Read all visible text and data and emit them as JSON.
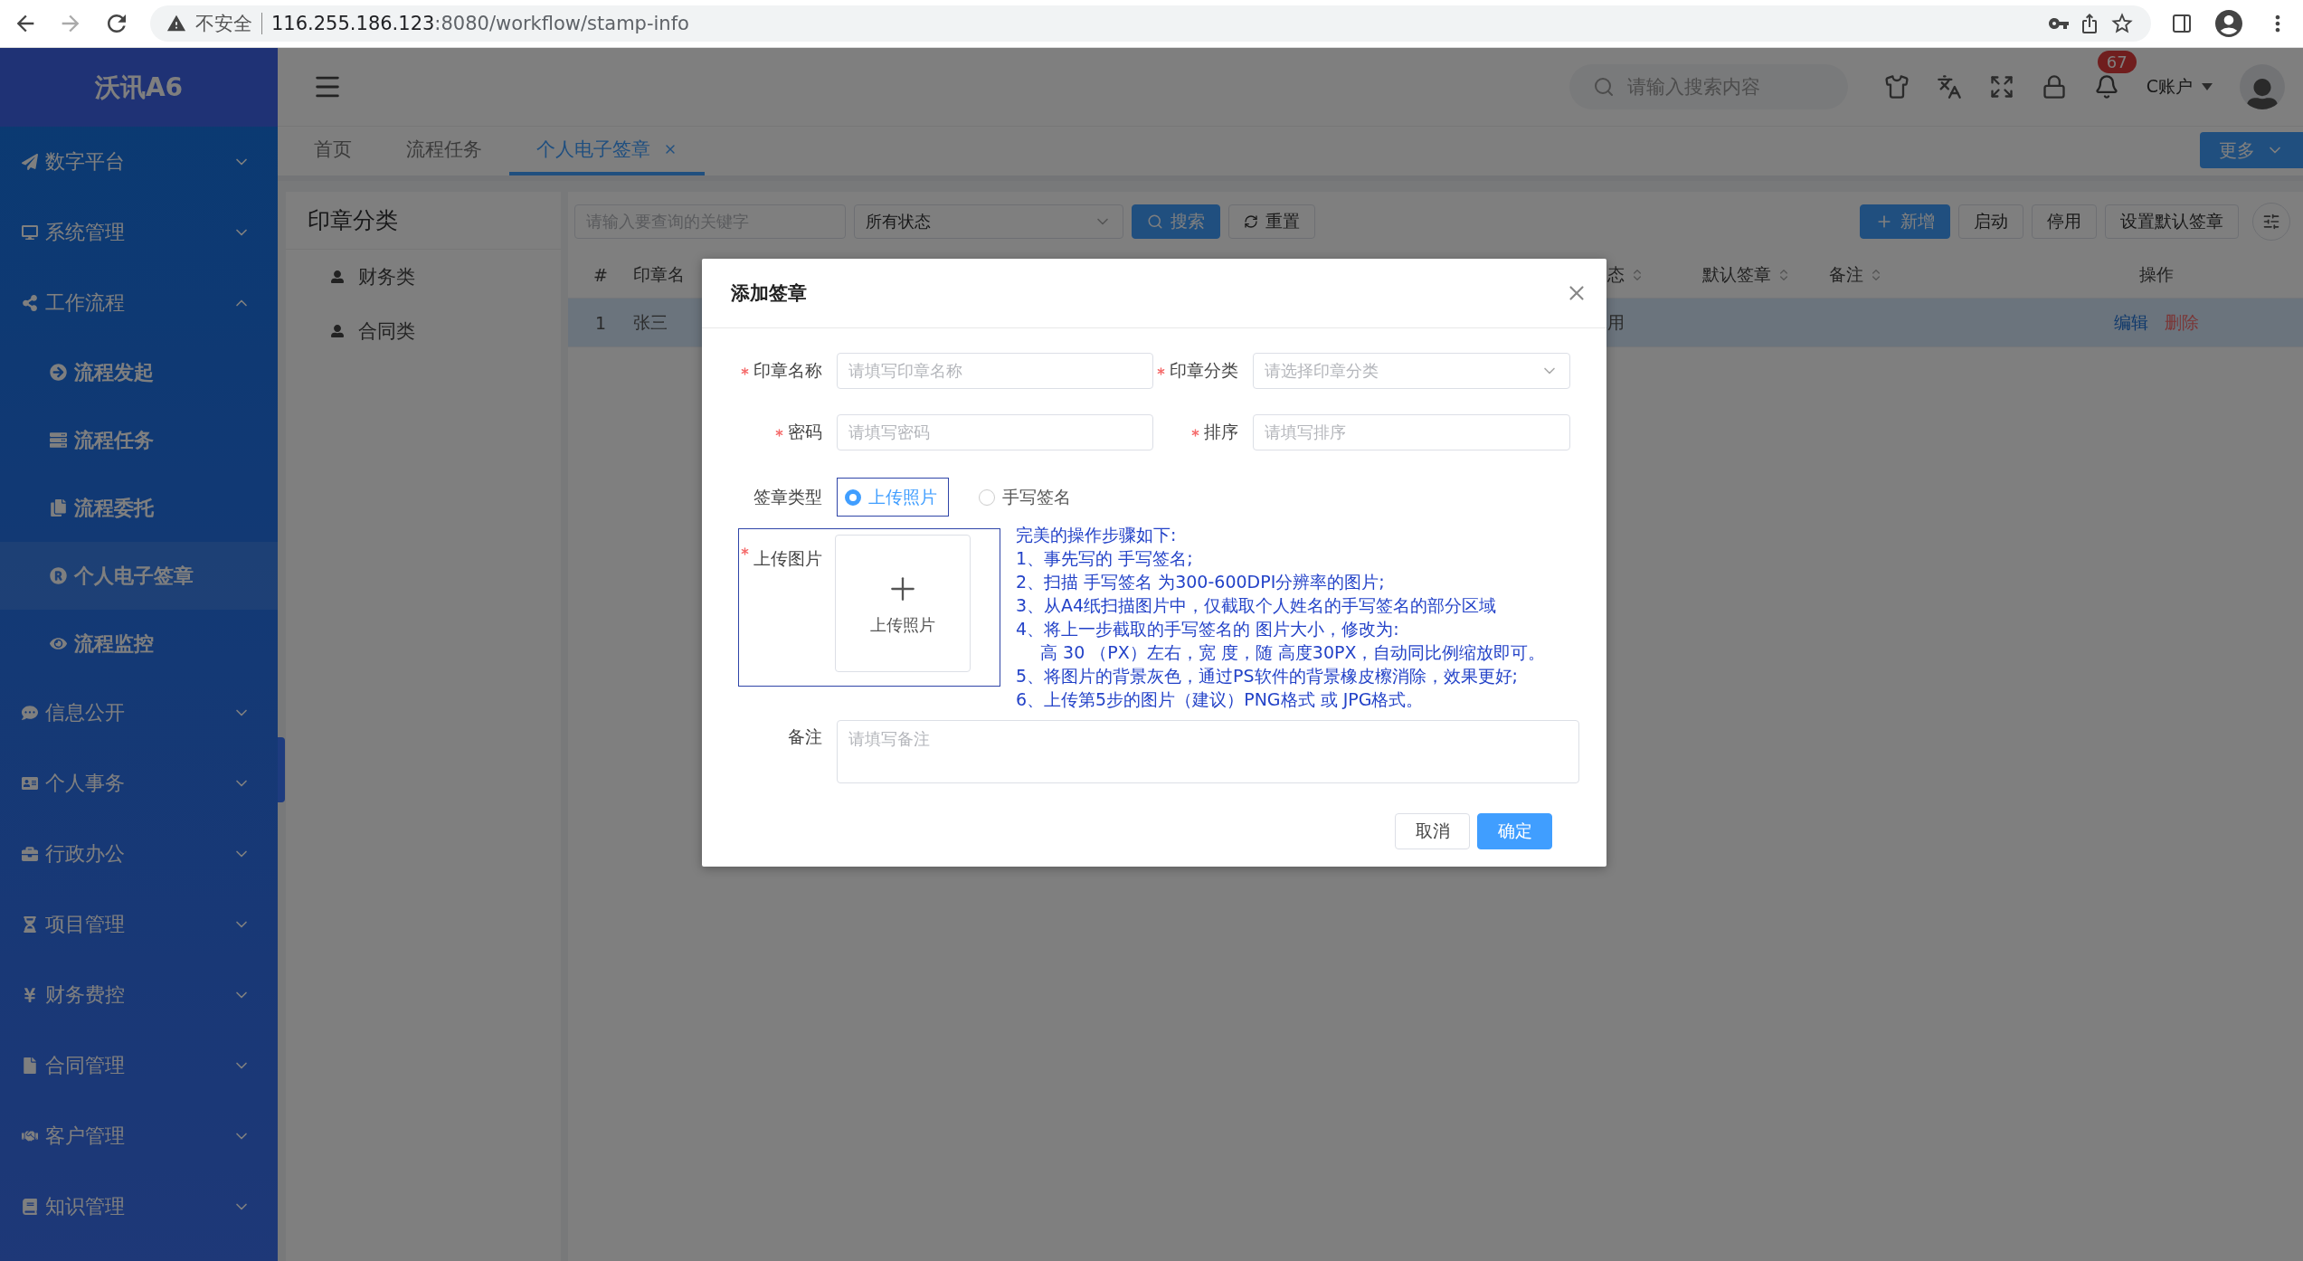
{
  "browser": {
    "security": "不安全",
    "url_host": "116.255.186.123",
    "url_path": ":8080/workflow/stamp-info"
  },
  "sidebar": {
    "logo": "沃讯A6",
    "items": [
      {
        "label": "数字平台",
        "expanded": false
      },
      {
        "label": "系统管理",
        "expanded": false
      },
      {
        "label": "工作流程",
        "expanded": true,
        "children": [
          {
            "label": "流程发起",
            "selected": false
          },
          {
            "label": "流程任务",
            "selected": false
          },
          {
            "label": "流程委托",
            "selected": false
          },
          {
            "label": "个人电子签章",
            "selected": true
          },
          {
            "label": "流程监控",
            "selected": false
          }
        ]
      },
      {
        "label": "信息公开",
        "expanded": false
      },
      {
        "label": "个人事务",
        "expanded": false
      },
      {
        "label": "行政办公",
        "expanded": false
      },
      {
        "label": "项目管理",
        "expanded": false
      },
      {
        "label": "财务费控",
        "expanded": false
      },
      {
        "label": "合同管理",
        "expanded": false
      },
      {
        "label": "客户管理",
        "expanded": false
      },
      {
        "label": "知识管理",
        "expanded": false
      }
    ]
  },
  "header": {
    "search_placeholder": "请输入搜索内容",
    "badge": "67",
    "account": "C账户"
  },
  "tabs": [
    {
      "label": "首页",
      "selected": false,
      "closable": false
    },
    {
      "label": "流程任务",
      "selected": false,
      "closable": false
    },
    {
      "label": "个人电子签章",
      "selected": true,
      "closable": true
    }
  ],
  "more_button": "更多",
  "category_panel": {
    "title": "印章分类",
    "items": [
      "财务类",
      "合同类"
    ]
  },
  "toolbar": {
    "keyword_placeholder": "请输入要查询的关键字",
    "status_select": "所有状态",
    "search": "搜索",
    "reset": "重置",
    "add": "新增",
    "buttons": [
      "启动",
      "停用",
      "设置默认签章"
    ]
  },
  "table": {
    "columns": [
      {
        "label": "#",
        "sortable": false
      },
      {
        "label": "印章名",
        "sortable": false
      },
      {
        "label": "态",
        "sortable": true
      },
      {
        "label": "默认签章",
        "sortable": true
      },
      {
        "label": "备注",
        "sortable": true
      },
      {
        "label": "操作",
        "sortable": false
      }
    ],
    "rows": [
      {
        "selected": true,
        "cells": [
          "1",
          "张三",
          "用"
        ],
        "actions": [
          "编辑",
          "删除"
        ]
      }
    ]
  },
  "dialog": {
    "title": "添加签章",
    "fields": [
      {
        "label": "印章名称",
        "required": true,
        "kind": "input",
        "placeholder": "请填写印章名称"
      },
      {
        "label": "印章分类",
        "required": true,
        "kind": "select",
        "placeholder": "请选择印章分类"
      },
      {
        "label": "密码",
        "required": true,
        "kind": "input",
        "placeholder": "请填写密码"
      },
      {
        "label": "排序",
        "required": true,
        "kind": "input",
        "placeholder": "请填写排序"
      }
    ],
    "type_label": "签章类型",
    "type_options": [
      {
        "label": "上传照片",
        "selected": true
      },
      {
        "label": "手写签名",
        "selected": false
      }
    ],
    "upload_label": "上传图片",
    "upload_required": true,
    "upload_button": "上传照片",
    "instructions": [
      {
        "kind": "heading",
        "text": "完美的操作步骤如下:"
      },
      {
        "kind": "step",
        "text": "1、事先写的 手写签名;"
      },
      {
        "kind": "step",
        "text": "2、扫描 手写签名  为300-600DPI分辨率的图片;"
      },
      {
        "kind": "step",
        "text": "3、从A4纸扫描图片中，仅截取个人姓名的手写签名的部分区域"
      },
      {
        "kind": "step",
        "text": "4、将上一步截取的手写签名的 图片大小，修改为:"
      },
      {
        "kind": "continuation",
        "text": "高 30 （PX）左右，宽 度，随 高度30PX，自动同比例缩放即可。"
      },
      {
        "kind": "step",
        "text": "5、将图片的背景灰色，通过PS软件的背景橡皮檫消除，效果更好;"
      },
      {
        "kind": "step",
        "text": "6、上传第5步的图片（建议）PNG格式 或 JPG格式。"
      }
    ],
    "remark_label": "备注",
    "remark_placeholder": "请填写备注",
    "cancel": "取消",
    "confirm": "确定"
  }
}
